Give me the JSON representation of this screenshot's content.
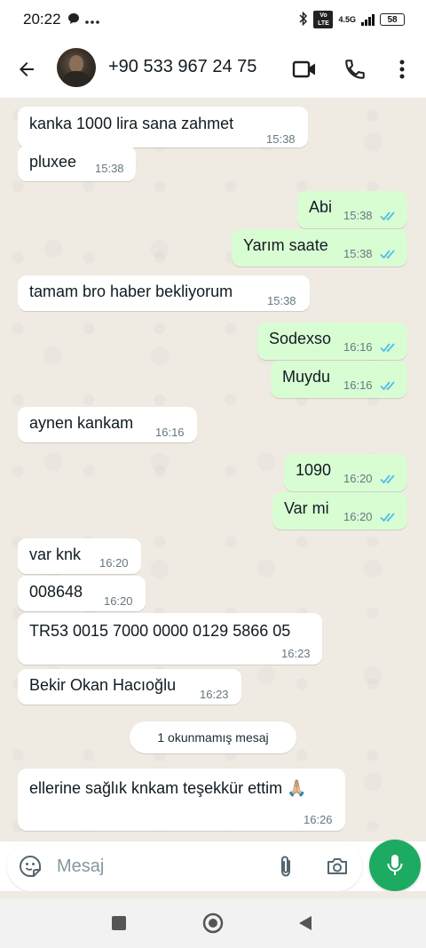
{
  "status_bar": {
    "time": "20:22",
    "network_badge": "Vo LTE",
    "network_type": "4.5G",
    "battery": "58"
  },
  "header": {
    "contact": "+90 533 967 24 75"
  },
  "messages": [
    {
      "direction": "in",
      "text": "kanka 1000 lira sana zahmet",
      "time": "15:38"
    },
    {
      "direction": "in",
      "text": "pluxee",
      "time": "15:38"
    },
    {
      "direction": "out",
      "text": "Abi",
      "time": "15:38",
      "status": "read"
    },
    {
      "direction": "out",
      "text": "Yarım saate",
      "time": "15:38",
      "status": "read"
    },
    {
      "direction": "in",
      "text": "tamam bro haber bekliyorum",
      "time": "15:38"
    },
    {
      "direction": "out",
      "text": "Sodexso",
      "time": "16:16",
      "status": "read"
    },
    {
      "direction": "out",
      "text": "Muydu",
      "time": "16:16",
      "status": "read"
    },
    {
      "direction": "in",
      "text": "aynen kankam",
      "time": "16:16"
    },
    {
      "direction": "out",
      "text": "1090",
      "time": "16:20",
      "status": "read"
    },
    {
      "direction": "out",
      "text": "Var mi",
      "time": "16:20",
      "status": "read"
    },
    {
      "direction": "in",
      "text": "var knk",
      "time": "16:20"
    },
    {
      "direction": "in",
      "text": "008648",
      "time": "16:20"
    },
    {
      "direction": "in",
      "text": "TR53 0015 7000 0000 0129 5866 05",
      "time": "16:23"
    },
    {
      "direction": "in",
      "text": "Bekir Okan Hacıoğlu",
      "time": "16:23"
    },
    {
      "direction": "in",
      "text": "ellerine sağlık knkam teşekkür ettim 🙏🏼",
      "time": "16:26"
    }
  ],
  "unread_divider": "1 okunmamış mesaj",
  "composer": {
    "placeholder": "Mesaj"
  },
  "colors": {
    "incoming_bubble": "#ffffff",
    "outgoing_bubble": "#d9fdd3",
    "chat_background": "#efeae2",
    "read_ticks": "#53bdeb",
    "mic_button": "#1daa61"
  }
}
